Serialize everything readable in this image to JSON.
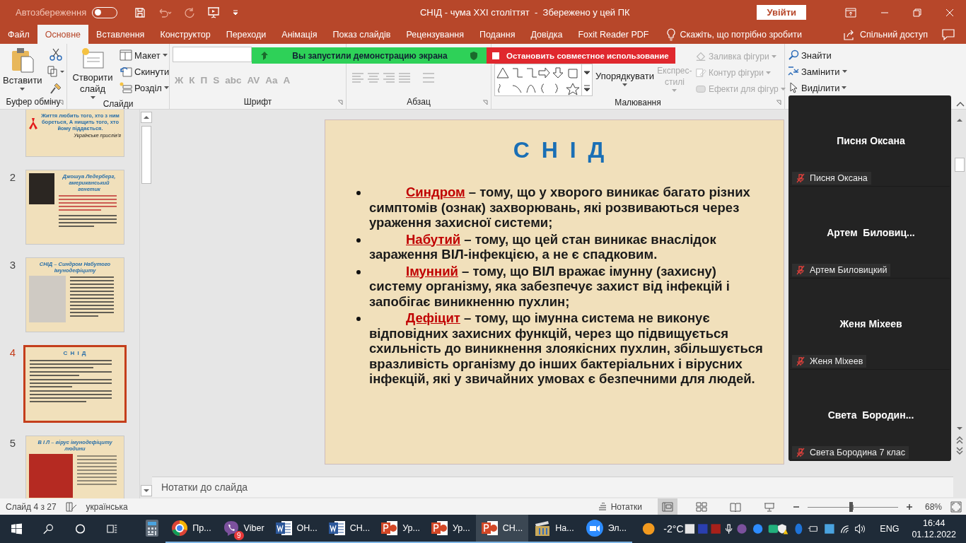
{
  "title_bar": {
    "autosave_label": "Автозбереження",
    "autosave_on": false,
    "title": "СНІД - чума ХХІ століттят  -  Збережено у цей ПК",
    "sign_in": "Увійти"
  },
  "tabs": [
    {
      "label": "Файл",
      "selected": false
    },
    {
      "label": "Основне",
      "selected": true
    },
    {
      "label": "Вставлення",
      "selected": false
    },
    {
      "label": "Конструктор",
      "selected": false
    },
    {
      "label": "Переходи",
      "selected": false
    },
    {
      "label": "Анімація",
      "selected": false
    },
    {
      "label": "Показ слайдів",
      "selected": false
    },
    {
      "label": "Рецензування",
      "selected": false
    },
    {
      "label": "Подання",
      "selected": false
    },
    {
      "label": "Довідка",
      "selected": false
    },
    {
      "label": "Foxit Reader PDF",
      "selected": false
    }
  ],
  "tell_me": "Скажіть, що потрібно зробити",
  "share": "Спільний доступ",
  "ribbon": {
    "clipboard": {
      "paste": "Вставити",
      "label": "Буфер обміну"
    },
    "slides": {
      "new_slide": "Створити слайд",
      "layout": "Макет",
      "reset": "Скинути",
      "section": "Розділ",
      "label": "Слайди"
    },
    "font": {
      "disabled": true,
      "buttons": [
        "Ж",
        "К",
        "П",
        "S",
        "abc",
        "AV",
        "Aa",
        "A"
      ],
      "label": "Шрифт"
    },
    "paragraph": {
      "label": "Абзац"
    },
    "drawing": {
      "arrange": "Упорядкувати",
      "quick_styles": {
        "label": "Експрес-стилі",
        "disabled": true
      },
      "tools": [
        {
          "label": "Заливка фігури",
          "kind": "fill",
          "disabled": true
        },
        {
          "label": "Контур фігури",
          "kind": "outline",
          "disabled": true
        },
        {
          "label": "Ефекти для фігур",
          "kind": "effects",
          "disabled": true
        }
      ],
      "label": "Малювання"
    },
    "editing": {
      "find": "Знайти",
      "replace": "Замінити",
      "select": "Виділити"
    }
  },
  "share_banner": {
    "message": "Вы запустили демонстрацию экрана",
    "stop": "Остановить совместное использование"
  },
  "thumbnails": [
    {
      "kind": "ribbon",
      "selected": false,
      "body": "Життя любить того, хто з ним бореться, А нищить того, хто йому піддається.",
      "caption": "Українське прислів'я"
    },
    {
      "number": "2",
      "kind": "portrait",
      "selected": false,
      "heading": "Джошуа Ледерберг, американський генетик"
    },
    {
      "number": "3",
      "kind": "title_portrait",
      "selected": false,
      "title": "СНІД – Синдром Набутого Імунодефіциту"
    },
    {
      "number": "4",
      "kind": "title_bullets",
      "selected": true,
      "title": "С Н І Д"
    },
    {
      "number": "5",
      "kind": "title_image",
      "selected": false,
      "title": "В І Л – вірус імунодефіциту людини"
    }
  ],
  "slide": {
    "title": "С Н І Д",
    "bullets": [
      {
        "term": "Синдром",
        "text": "– тому, що у хворого виникає багато різних симптомів (ознак) захворювань, які розвиваються через ураження захисної системи;"
      },
      {
        "term": "Набутий",
        "text": "– тому, що цей стан виникає  внаслідок зараження ВІЛ-інфекцією, а не є спадковим."
      },
      {
        "term": "Імунний",
        "text": "– тому, що ВІЛ вражає імунну (захисну) систему організму, яка забезпечує захист від  інфекцій і запобігає виникненню пухлин;"
      },
      {
        "term": "Дефіцит",
        "text": "– тому,  що імунна система не виконує відповідних захисних функцій, через що підвищується схильність до виникнення злоякісних пухлин, збільшується вразливість організму до інших бактеріальних і вірусних інфекцій, які у звичайних умовах є безпечними для людей."
      }
    ]
  },
  "notes_placeholder": "Нотатки до слайда",
  "participants": [
    {
      "display_name": "Писня Оксана",
      "label": "Писня Оксана",
      "muted": true
    },
    {
      "display_name": "Артем  Биловиц...",
      "label": "Артем Биловицкий",
      "muted": true
    },
    {
      "display_name": "Женя Міхеев",
      "label": "Женя Міхеев",
      "muted": true
    },
    {
      "display_name": "Света  Бородин...",
      "label": "Света Бородина 7 клас",
      "muted": true
    }
  ],
  "status_bar": {
    "slide_count": "Слайд 4 з 27",
    "language": "українська",
    "notes": "Нотатки",
    "views": [
      {
        "kind": "normal",
        "selected": true
      },
      {
        "kind": "sorter",
        "selected": false
      },
      {
        "kind": "reading",
        "selected": false
      },
      {
        "kind": "show",
        "selected": false
      }
    ],
    "zoom": {
      "level": 0.48,
      "reading": "68%"
    }
  },
  "taskbar": {
    "apps": [
      {
        "kind": "calculator",
        "open": false,
        "active": false
      },
      {
        "kind": "chrome",
        "label": "Пр...",
        "open": true,
        "active": false
      },
      {
        "kind": "viber",
        "label": "Viber",
        "badge": "9",
        "open": true,
        "active": false
      },
      {
        "kind": "word",
        "label": "ОН...",
        "open": true,
        "active": false
      },
      {
        "kind": "word",
        "label": "СН...",
        "open": true,
        "active": false
      },
      {
        "kind": "powerpoint",
        "label": "Ур...",
        "open": true,
        "active": false
      },
      {
        "kind": "powerpoint",
        "label": "Ур...",
        "open": true,
        "active": false
      },
      {
        "kind": "powerpoint",
        "label": "СН...",
        "open": true,
        "active": true
      },
      {
        "kind": "video",
        "label": "На...",
        "open": true,
        "active": false
      },
      {
        "kind": "zoom",
        "label": "Эл...",
        "open": true,
        "active": false
      }
    ],
    "weather": "-2°C",
    "language": "ENG",
    "time": "16:44",
    "date": "01.12.2022"
  }
}
